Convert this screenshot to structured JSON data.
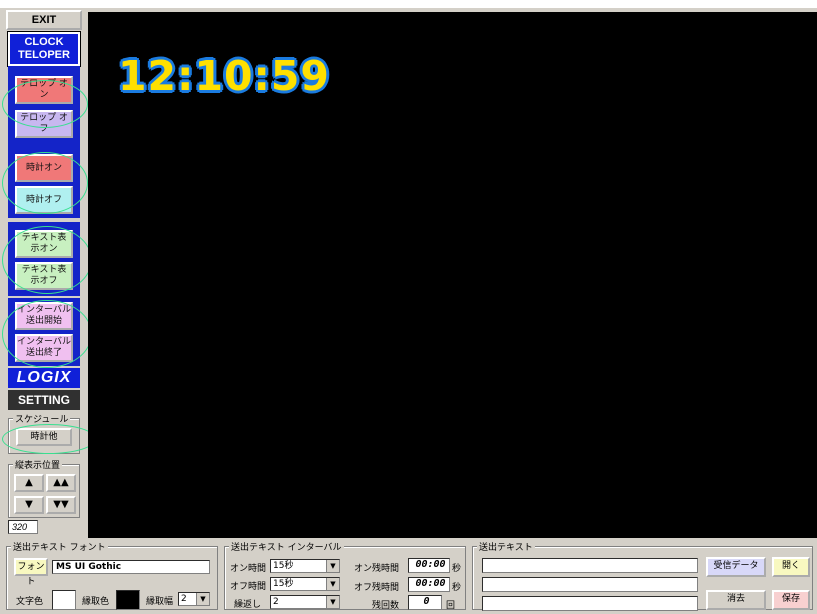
{
  "sidebar": {
    "exit_label": "EXIT",
    "brand_line1": "CLOCK",
    "brand_line2": "TELOPER",
    "buttons": [
      {
        "label": "テロップ オン",
        "color": "#f07878"
      },
      {
        "label": "テロップ オフ",
        "color": "#c8b8f0"
      },
      {
        "label": "時計オン",
        "color": "#f07878"
      },
      {
        "label": "時計オフ",
        "color": "#b0f0f0"
      },
      {
        "label": "テキスト表 示オン",
        "color": "#c8f0c0"
      },
      {
        "label": "テキスト表 示オフ",
        "color": "#c8f0c0"
      },
      {
        "label": "インターバル 送出開始",
        "color": "#f0c0f0"
      },
      {
        "label": "インターバル 送出終了",
        "color": "#f0c0f0"
      }
    ],
    "logix_label": "LOGIX",
    "setting_label": "SETTING",
    "schedule_legend": "スケジュール",
    "schedule_button": "時計他",
    "position_legend": "縦表示位置",
    "arrow_up": "▲",
    "arrow_up_fast": "▲▲",
    "arrow_down": "▼",
    "arrow_down_fast": "▼▼",
    "position_value": "320"
  },
  "screen": {
    "clock_text": "12:10:59"
  },
  "font_panel": {
    "legend": "送出テキスト フォント",
    "font_button": "フォント",
    "font_name": "MS UI Gothic",
    "text_color_label": "文字色",
    "outline_color_label": "縁取色",
    "outline_width_label": "縁取幅",
    "outline_width_value": "2"
  },
  "interval_panel": {
    "legend": "送出テキスト インターバル",
    "on_time_label": "オン時間",
    "on_time_value": "15秒",
    "off_time_label": "オフ時間",
    "off_time_value": "15秒",
    "repeat_label": "繰返し",
    "repeat_value": "2",
    "on_remaining_label": "オン残時間",
    "on_remaining_value": "00:00",
    "off_remaining_label": "オフ残時間",
    "off_remaining_value": "00:00",
    "seconds_unit": "秒",
    "remaining_count_label": "残回数",
    "remaining_count_value": "0",
    "count_unit": "回"
  },
  "text_panel": {
    "legend": "送出テキスト",
    "line1": "",
    "line2": "",
    "line3": "",
    "receive_button": "受信データ",
    "open_button": "開く",
    "clear_button": "消去",
    "save_button": "保存"
  },
  "colors": {
    "screen_bg": "#000000",
    "clock_fill": "#ffe000",
    "clock_outline": "#1a7be0",
    "brand_blue": "#1020d8",
    "text_color_swatch": "#ffffff",
    "outline_color_swatch": "#000000",
    "receive_button_bg": "#d8d8f8",
    "open_button_bg": "#f8f8c0",
    "save_button_bg": "#f8d0d0"
  }
}
